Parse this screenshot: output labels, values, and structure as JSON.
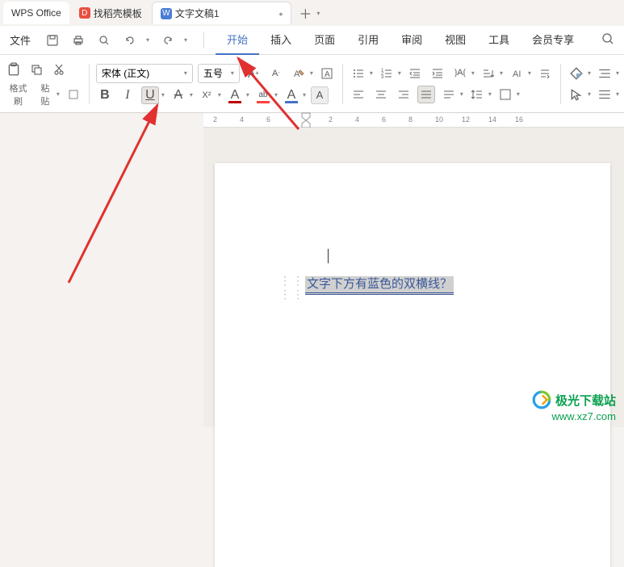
{
  "titlebar": {
    "app_name": "WPS Office",
    "tabs": [
      {
        "label": "找稻壳模板",
        "icon": "D"
      },
      {
        "label": "文字文稿1",
        "icon": "W"
      }
    ],
    "add": "＋"
  },
  "menu": {
    "file": "文件",
    "tabs": [
      "开始",
      "插入",
      "页面",
      "引用",
      "审阅",
      "视图",
      "工具",
      "会员专享"
    ],
    "active_index": 0
  },
  "toolbar": {
    "format_painter": "格式刷",
    "paste": "粘贴",
    "font_name": "宋体 (正文)",
    "font_size": "五号",
    "bold": "B",
    "italic": "I",
    "underline": "U",
    "strike": "S",
    "super": "X²",
    "char_a": "A",
    "ab": "ab",
    "font_color": "#c00000",
    "highlight_color": "#ffff00",
    "underline_color": "#4472c4"
  },
  "ruler": {
    "ticks": [
      "2",
      "4",
      "6",
      "2",
      "4",
      "6",
      "8",
      "10",
      "12",
      "14",
      "16"
    ]
  },
  "document": {
    "selected_text": "文字下方有蓝色的双横线？"
  },
  "watermark": {
    "name": "极光下载站",
    "url": "www.xz7.com"
  }
}
